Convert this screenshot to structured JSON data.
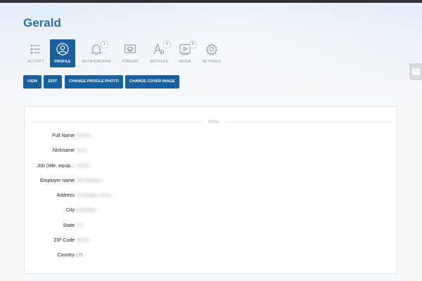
{
  "profile": {
    "name": "Gerald"
  },
  "tabs": [
    {
      "id": "activity",
      "label": "ACTIVITY",
      "icon": "activity-list-icon",
      "active": false,
      "badge": ""
    },
    {
      "id": "profile",
      "label": "PROFILE",
      "icon": "user-icon",
      "active": true,
      "badge": ""
    },
    {
      "id": "notifications",
      "label": "NOTIFICATIONS",
      "icon": "bell-icon",
      "active": false,
      "badge": "1"
    },
    {
      "id": "forums",
      "label": "FORUMS",
      "icon": "forum-icon",
      "active": false,
      "badge": ""
    },
    {
      "id": "articles",
      "label": "ARTICLES",
      "icon": "article-icon",
      "active": false,
      "badge": "0"
    },
    {
      "id": "media",
      "label": "MEDIA",
      "icon": "media-play-icon",
      "active": false,
      "badge": "0"
    },
    {
      "id": "settings",
      "label": "SETTINGS",
      "icon": "gear-icon",
      "active": false,
      "badge": ""
    }
  ],
  "actions": {
    "view": "VIEW",
    "edit": "EDIT",
    "change_photo": "CHANGE PROFILE PHOTO",
    "change_cover": "CHANGE COVER IMAGE"
  },
  "section": {
    "title": "BASE"
  },
  "fields": [
    {
      "label": "Full Name",
      "value": "Gerald",
      "blurred": true
    },
    {
      "label": "Nickname",
      "value": "Jerry",
      "blurred": true
    },
    {
      "label": "Job (title, equip...",
      "value": "Owner",
      "blurred": true
    },
    {
      "label": "Employer name",
      "value": "Fire Badges",
      "blurred": true
    },
    {
      "label": "Address",
      "value": "58 Golden Drive",
      "blurred": true
    },
    {
      "label": "City",
      "value": "Westlake",
      "blurred": true
    },
    {
      "label": "State",
      "value": "OH",
      "blurred": true
    },
    {
      "label": "ZIP Code",
      "value": "00000",
      "blurred": true
    },
    {
      "label": "Country",
      "value": "US",
      "blurred": false
    }
  ],
  "colors": {
    "accent": "#1a5f9e",
    "name_blue": "#2c6fab",
    "tab_inactive": "#8b9099"
  },
  "side_widget": {
    "icon": "mail-icon"
  }
}
